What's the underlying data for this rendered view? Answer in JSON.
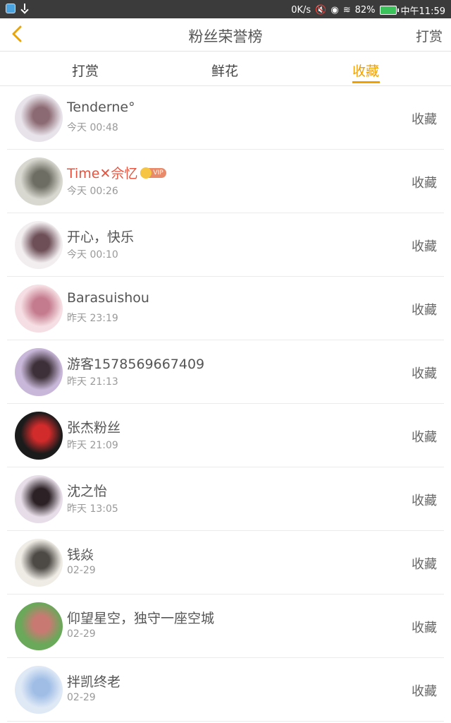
{
  "status_bar": {
    "speed": "0K/s",
    "battery_pct": "82%",
    "clock": "中午11:59"
  },
  "header": {
    "title": "粉丝荣誉榜",
    "right_action": "打赏"
  },
  "tabs": [
    {
      "label": "打赏",
      "active": false
    },
    {
      "label": "鲜花",
      "active": false
    },
    {
      "label": "收藏",
      "active": true
    }
  ],
  "colors": {
    "accent": "#f0a100",
    "vip_name": "#e2543f"
  },
  "fans": [
    {
      "name": "Tenderne°",
      "time": "今天 00:48",
      "action": "收藏",
      "vip": false,
      "avatar_colors": [
        "#e8e3ea",
        "#8c6a73"
      ]
    },
    {
      "name": "Time✕佘忆",
      "time": "今天 00:26",
      "action": "收藏",
      "vip": true,
      "vip_label": "VIP",
      "avatar_colors": [
        "#d8d8d0",
        "#6d6d63"
      ]
    },
    {
      "name": "开心，快乐",
      "time": "今天 00:10",
      "action": "收藏",
      "vip": false,
      "avatar_colors": [
        "#f2eef0",
        "#6e4f58"
      ]
    },
    {
      "name": "Barasuishou",
      "time": "昨天 23:19",
      "action": "收藏",
      "vip": false,
      "avatar_colors": [
        "#f6dfe4",
        "#c47b8e"
      ]
    },
    {
      "name": "游客1578569667409",
      "time": "昨天 21:13",
      "action": "收藏",
      "vip": false,
      "avatar_colors": [
        "#c9b7d9",
        "#3d3038"
      ]
    },
    {
      "name": "张杰粉丝",
      "time": "昨天 21:09",
      "action": "收藏",
      "vip": false,
      "avatar_colors": [
        "#1b1b1b",
        "#d12b2b"
      ]
    },
    {
      "name": "沈之怡",
      "time": "昨天 13:05",
      "action": "收藏",
      "vip": false,
      "avatar_colors": [
        "#e6dde8",
        "#2c2226"
      ]
    },
    {
      "name": "钱焱",
      "time": "02-29",
      "action": "收藏",
      "vip": false,
      "avatar_colors": [
        "#efece6",
        "#4d4a45"
      ]
    },
    {
      "name": "仰望星空，独守一座空城",
      "time": "02-29",
      "action": "收藏",
      "vip": false,
      "avatar_colors": [
        "#6aa85a",
        "#c87a72"
      ]
    },
    {
      "name": "拌凯终老",
      "time": "02-29",
      "action": "收藏",
      "vip": false,
      "avatar_colors": [
        "#dfe9f6",
        "#9fbde5"
      ]
    }
  ]
}
